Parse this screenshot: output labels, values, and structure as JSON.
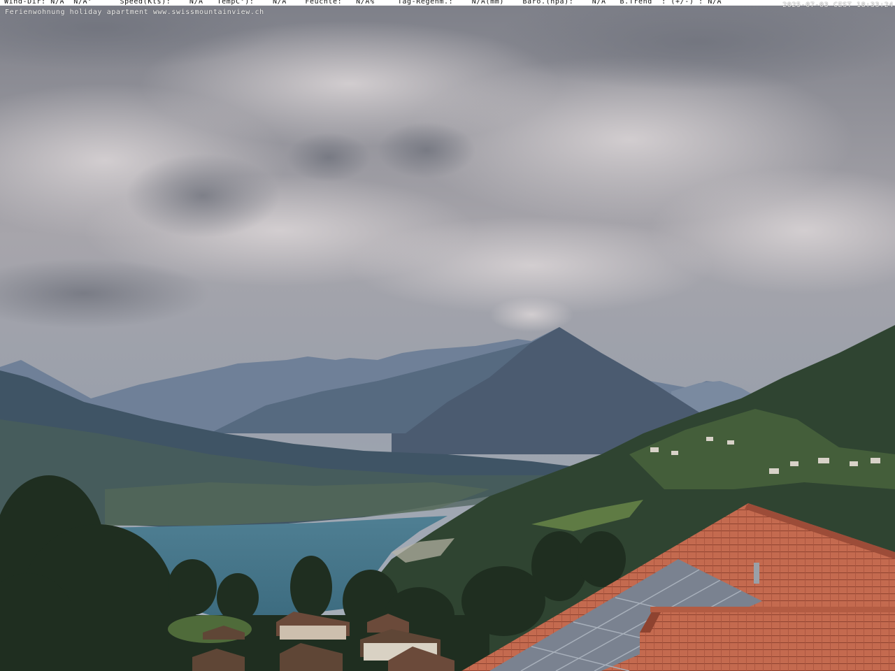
{
  "overlay": {
    "weather_line": "Wind-Dir: N/A  N/A°      Speed(Kts):    N/A   TempC°):    N/A    Feuchte:   N/A%     Tag-Regenm.:    N/A(mm)    Baro.(hpa):    N/A   B.Trend  : (+/-) : N/A",
    "timestamp": "2025-07-03 CEST 18:33:24",
    "caption": "Ferienwohnung holiday apartment www.swissmountainview.ch"
  },
  "colors": {
    "sky": "#8e9099",
    "cloud": "#c9c6c9",
    "mountain_far": "#6b7d94",
    "mountain_near": "#4c5c72",
    "lake": "#5b8799",
    "forest": "#2c3d2c",
    "roof": "#c0644a",
    "solar": "#7e8793"
  }
}
